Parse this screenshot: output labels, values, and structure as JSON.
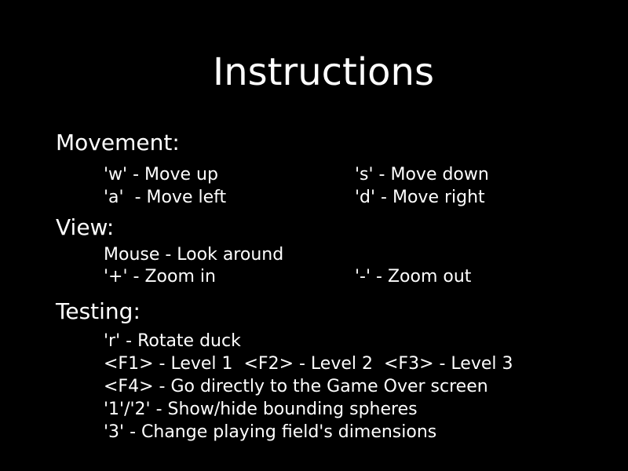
{
  "title": "Instructions",
  "sections": {
    "movement": {
      "heading": "Movement:",
      "items": [
        "'w' - Move up",
        "'s' - Move down",
        "'a'  - Move left",
        "'d' - Move right"
      ]
    },
    "view": {
      "heading": "View:",
      "items": [
        "Mouse - Look around",
        "'+' - Zoom in",
        "'-' - Zoom out"
      ]
    },
    "testing": {
      "heading": "Testing:",
      "items": [
        "'r' - Rotate duck",
        "<F1> - Level 1  <F2> - Level 2  <F3> - Level 3",
        "<F4> - Go directly to the Game Over screen",
        "'1'/'2' - Show/hide bounding spheres",
        "'3' - Change playing field's dimensions"
      ]
    }
  },
  "colors": {
    "background": "#000000",
    "text": "#ffffff"
  }
}
